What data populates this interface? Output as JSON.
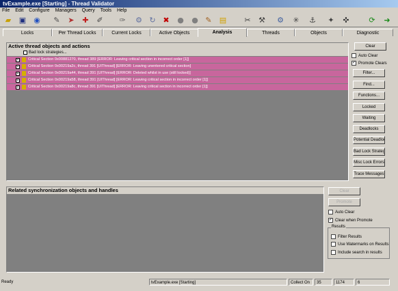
{
  "window": {
    "title": "tvExample.exe [Starting] - Thread Validator"
  },
  "menu": [
    "File",
    "Edit",
    "Configure",
    "Managers",
    "Query",
    "Tools",
    "Help"
  ],
  "tabs": [
    "Locks",
    "Per Thread Locks",
    "Current Locks",
    "Active Objects",
    "Analysis",
    "Threads",
    "Objects",
    "Diagnostic"
  ],
  "active_tab": "Analysis",
  "active_panel": {
    "title": "Active thread objects and actions",
    "root": "Bad lock strategies...",
    "rows": [
      "Critical Section 0x00881270, thread 389 [ERROR: Leaving critical section in incorrect order [1]]",
      "Critical Section 0x00219a2c, thread 391 [UIThread] [ERROR: Leaving unentered critical section]",
      "Critical Section 0x00219a44, thread 391 [UIThread] [ERROR: Deleted whilst in use (still locked)]",
      "Critical Section 0x00219a58, thread 391 [UIThread] [ERROR: Leaving critical section in incorrect order [1]]",
      "Critical Section 0x00219a8c, thread 391 [UIThread] [ERROR: Leaving critical section in incorrect order [1]]"
    ]
  },
  "right_controls": {
    "clear": "Clear",
    "auto_clear": "Auto Clear",
    "promote_clears": "Promote Clears",
    "buttons": [
      "Filter...",
      "Find...",
      "Functions...",
      "Locked",
      "Waiting",
      "Deadlocks",
      "Potential Deadlocks",
      "Bad Lock Strategy",
      "Misc Lock Errors",
      "Trace Messages"
    ]
  },
  "related_panel": {
    "title": "Related synchronization objects and handles",
    "clear": "Clear",
    "promote": "Promote",
    "auto_clear": "Auto Clear",
    "clear_when_promote": "Clear when Promote",
    "results_label": "Results",
    "results": [
      "Filter Results",
      "Use Watermarks on Results",
      "Include search in results"
    ]
  },
  "status": {
    "ready": "Ready",
    "process": "tvExample.exe [Starting]",
    "collect": "Collect On",
    "n1": "35",
    "n2": "1174",
    "n3": "6"
  }
}
